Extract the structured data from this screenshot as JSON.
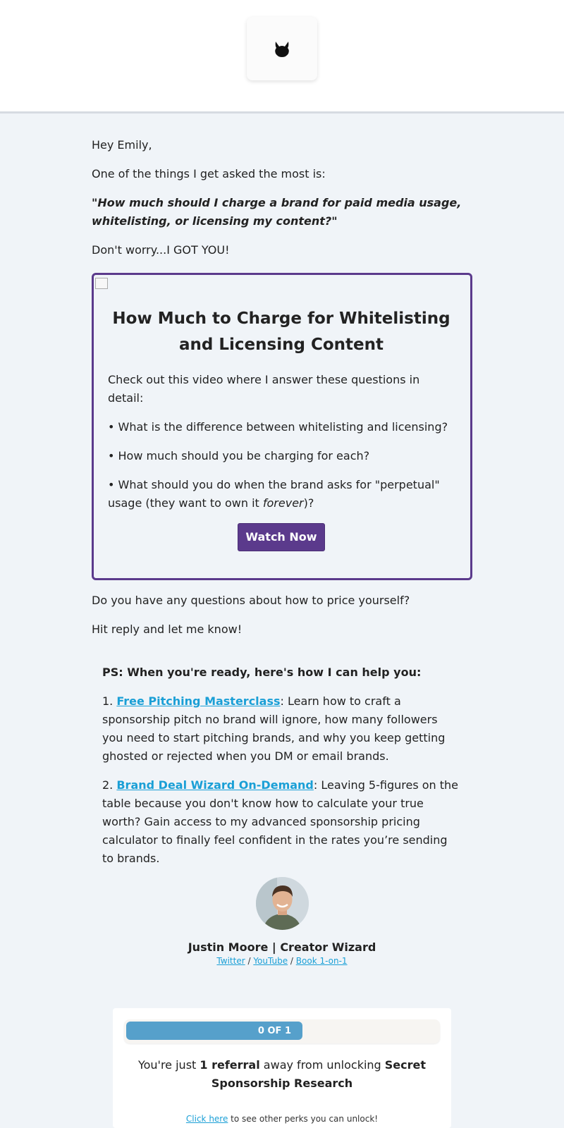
{
  "header": {
    "logo_icon": "cat-logo-icon"
  },
  "email": {
    "greeting": "Hey Emily,",
    "intro": "One of the things I get asked the most is:",
    "quote": "\"How much should I charge a brand for paid media usage, whitelisting, or licensing my content?\"",
    "reassure": "Don't worry...I GOT YOU!",
    "card": {
      "title": "How Much to Charge for Whitelisting and Licensing Content",
      "lead": "Check out this video where I answer these questions in detail:",
      "bullet1": "• What is the difference between whitelisting and licensing?",
      "bullet2": "• How much should you be charging for each?",
      "bullet3_pre": "• What should you do when the brand asks for \"perpetual\" usage (they want to own it ",
      "bullet3_em": "forever",
      "bullet3_post": ")?",
      "button": "Watch Now"
    },
    "question": "Do you have any questions about how to price yourself?",
    "reply": "Hit reply and let me know!",
    "ps": {
      "title": "PS: When you're ready, here's how I can help you:",
      "item1_num": "1. ",
      "item1_link": "Free Pitching Masterclass",
      "item1_text": ": Learn how to craft a sponsorship pitch no brand will ignore, how many followers you need to start pitching brands, and why you keep getting ghosted or rejected when you DM or email brands.",
      "item2_num": "2. ",
      "item2_link": "Brand Deal Wizard On-Demand",
      "item2_text": ": Leaving 5-figures on the table because you don't know how to calculate your true worth? Gain access to my advanced sponsorship pricing calculator to finally feel confident in the rates you’re sending to brands."
    }
  },
  "signature": {
    "name": "Justin Moore | Creator Wizard",
    "link_twitter": "Twitter",
    "link_youtube": "YouTube",
    "link_book": "Book 1-on-1",
    "sep": " / "
  },
  "referral": {
    "progress_label": "0 OF 1",
    "progress_fraction": 0,
    "text_pre": "You're just ",
    "text_bold1": "1 referral",
    "text_mid": " away from unlocking ",
    "text_bold2": "Secret Sponsorship Research",
    "sub_link": "Click here",
    "sub_text": " to see other perks you can unlock!"
  },
  "colors": {
    "accent_purple": "#5b3a8c",
    "link_blue": "#1a9fd6",
    "progress_blue": "#56a0cb"
  }
}
